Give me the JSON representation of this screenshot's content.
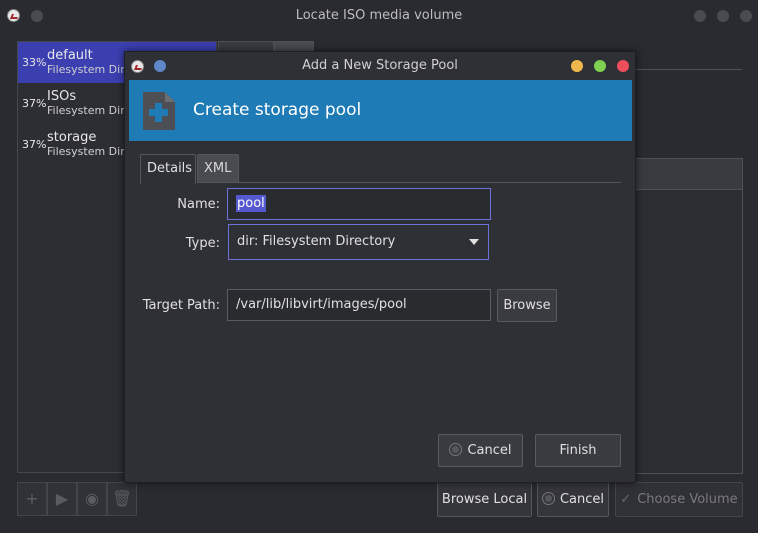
{
  "parent_window": {
    "title": "Locate ISO media volume",
    "pools": [
      {
        "percent": "33%",
        "name": "default",
        "type": "Filesystem Directory",
        "selected": true
      },
      {
        "percent": "37%",
        "name": "ISOs",
        "type": "Filesystem Directory",
        "selected": false
      },
      {
        "percent": "37%",
        "name": "storage",
        "type": "Filesystem Directory",
        "selected": false
      }
    ],
    "buttons": {
      "browse_local": "Browse Local",
      "cancel": "Cancel",
      "choose_volume": "Choose Volume"
    }
  },
  "dialog": {
    "title": "Add a New Storage Pool",
    "banner_title": "Create storage pool",
    "tabs": {
      "details": "Details",
      "xml": "XML"
    },
    "form": {
      "name_label": "Name:",
      "name_value": "pool",
      "type_label": "Type:",
      "type_value": "dir: Filesystem Directory",
      "target_path_label": "Target Path:",
      "target_path_value": "/var/lib/libvirt/images/pool",
      "browse_label": "Browse"
    },
    "buttons": {
      "cancel": "Cancel",
      "finish": "Finish"
    }
  },
  "colors": {
    "banner": "#1e7bb5",
    "selection": "#3b3fb0",
    "focus": "#6e73d8",
    "wm_minimize": "#f0b84b",
    "wm_maximize": "#7fcf52",
    "wm_close": "#ee4d5c"
  }
}
